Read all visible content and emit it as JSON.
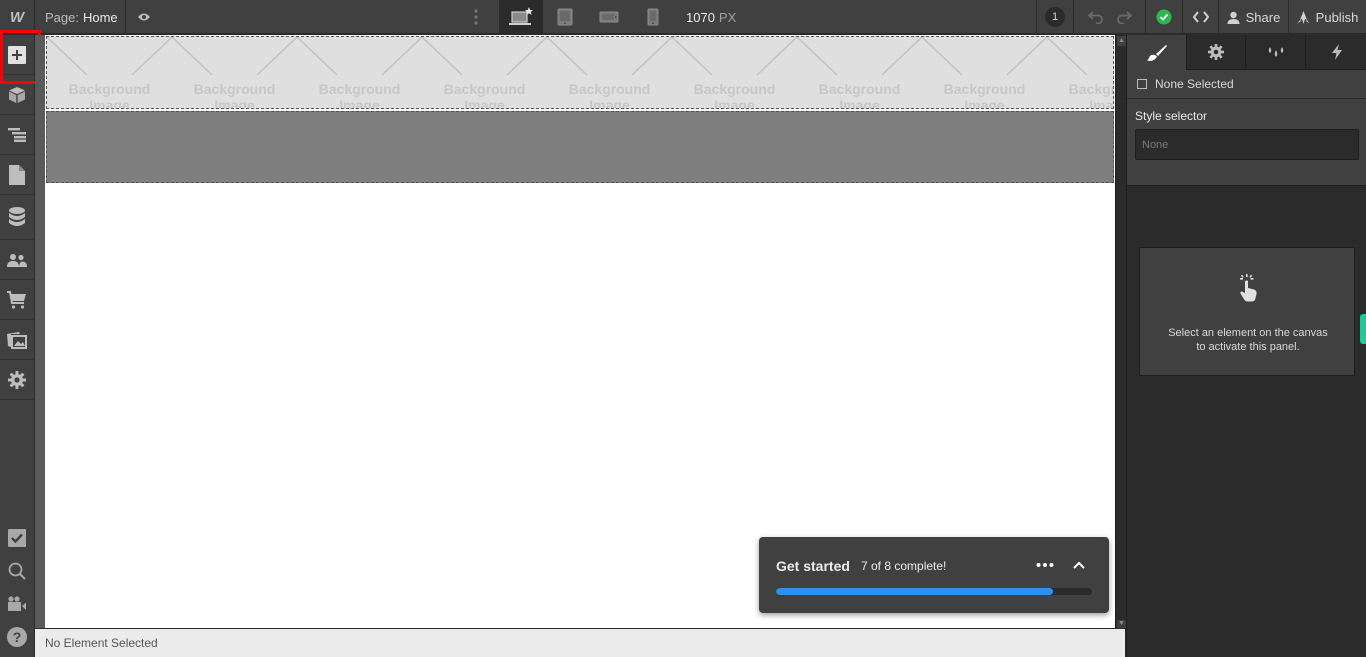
{
  "topbar": {
    "logo": "W",
    "page_prefix": "Page:",
    "page_name": "Home",
    "width_value": "1070",
    "width_unit": "PX",
    "notifications_count": "1",
    "share_label": "Share",
    "publish_label": "Publish",
    "devices": [
      {
        "name": "desktop",
        "active": true
      },
      {
        "name": "tablet",
        "active": false
      },
      {
        "name": "mobile-landscape",
        "active": false
      },
      {
        "name": "mobile-portrait",
        "active": false
      }
    ],
    "status_color": "#2db84d"
  },
  "leftbar": {
    "items": [
      "add",
      "components",
      "navigator",
      "pages",
      "cms",
      "users",
      "ecommerce",
      "assets",
      "settings"
    ],
    "bottom_items": [
      "checklist",
      "search",
      "video-tutorials",
      "help"
    ],
    "highlight_color": "#ff0000"
  },
  "canvas": {
    "bg_placeholder_line1": "Background",
    "bg_placeholder_line2": "Image",
    "tile_count": 9
  },
  "statusbar": {
    "text": "No Element Selected"
  },
  "rpanel": {
    "tabs": [
      "style",
      "settings",
      "style-manager",
      "interactions"
    ],
    "none_selected": "None Selected",
    "style_selector_label": "Style selector",
    "style_selector_placeholder": "None",
    "empty_message_line1": "Select an element on the canvas",
    "empty_message_line2": "to activate this panel."
  },
  "getstarted": {
    "title": "Get started",
    "subtitle": "7 of 8 complete!",
    "completed": 7,
    "total": 8,
    "progress_color": "#2d8ff0"
  }
}
